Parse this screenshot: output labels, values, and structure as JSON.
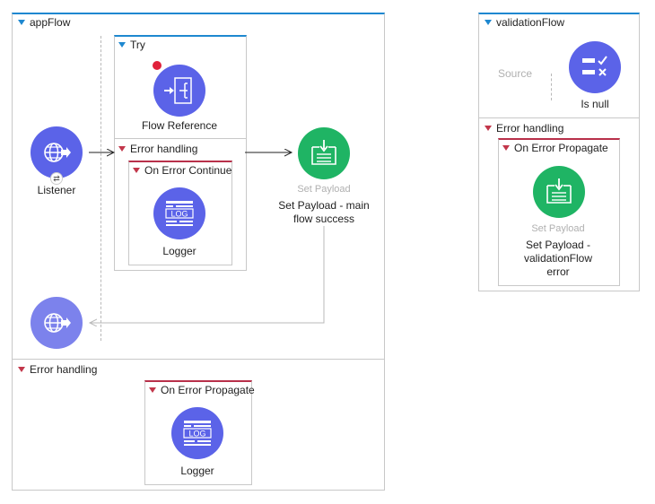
{
  "app_flow": {
    "title": "appFlow",
    "listener": {
      "label": "Listener",
      "icon": "globe-arrow-icon"
    },
    "try": {
      "title": "Try",
      "flow_reference": {
        "label": "Flow Reference",
        "icon": "flow-reference-icon"
      },
      "error_handling": {
        "title": "Error handling",
        "on_error": {
          "title": "On Error Continue",
          "logger": {
            "label": "Logger",
            "icon": "log-icon",
            "icon_text": "LOG"
          }
        }
      }
    },
    "set_payload": {
      "type_label": "Set Payload",
      "label": "Set Payload - main flow success",
      "icon": "set-payload-icon"
    },
    "error_handling": {
      "title": "Error handling",
      "on_error": {
        "title": "On Error Propagate",
        "logger": {
          "label": "Logger",
          "icon": "log-icon",
          "icon_text": "LOG"
        }
      }
    }
  },
  "validation_flow": {
    "title": "validationFlow",
    "source_label": "Source",
    "is_null": {
      "label": "Is null",
      "icon": "validation-icon"
    },
    "error_handling": {
      "title": "Error handling",
      "on_error": {
        "title": "On Error Propagate",
        "set_payload": {
          "type_label": "Set Payload",
          "label": "Set Payload - validationFlow error",
          "icon": "set-payload-icon"
        }
      }
    }
  },
  "colors": {
    "flow_accent": "#1e88d0",
    "error_accent": "#c2364a",
    "connector_blue": "#5b63e8",
    "transformer_green": "#1fb464"
  }
}
